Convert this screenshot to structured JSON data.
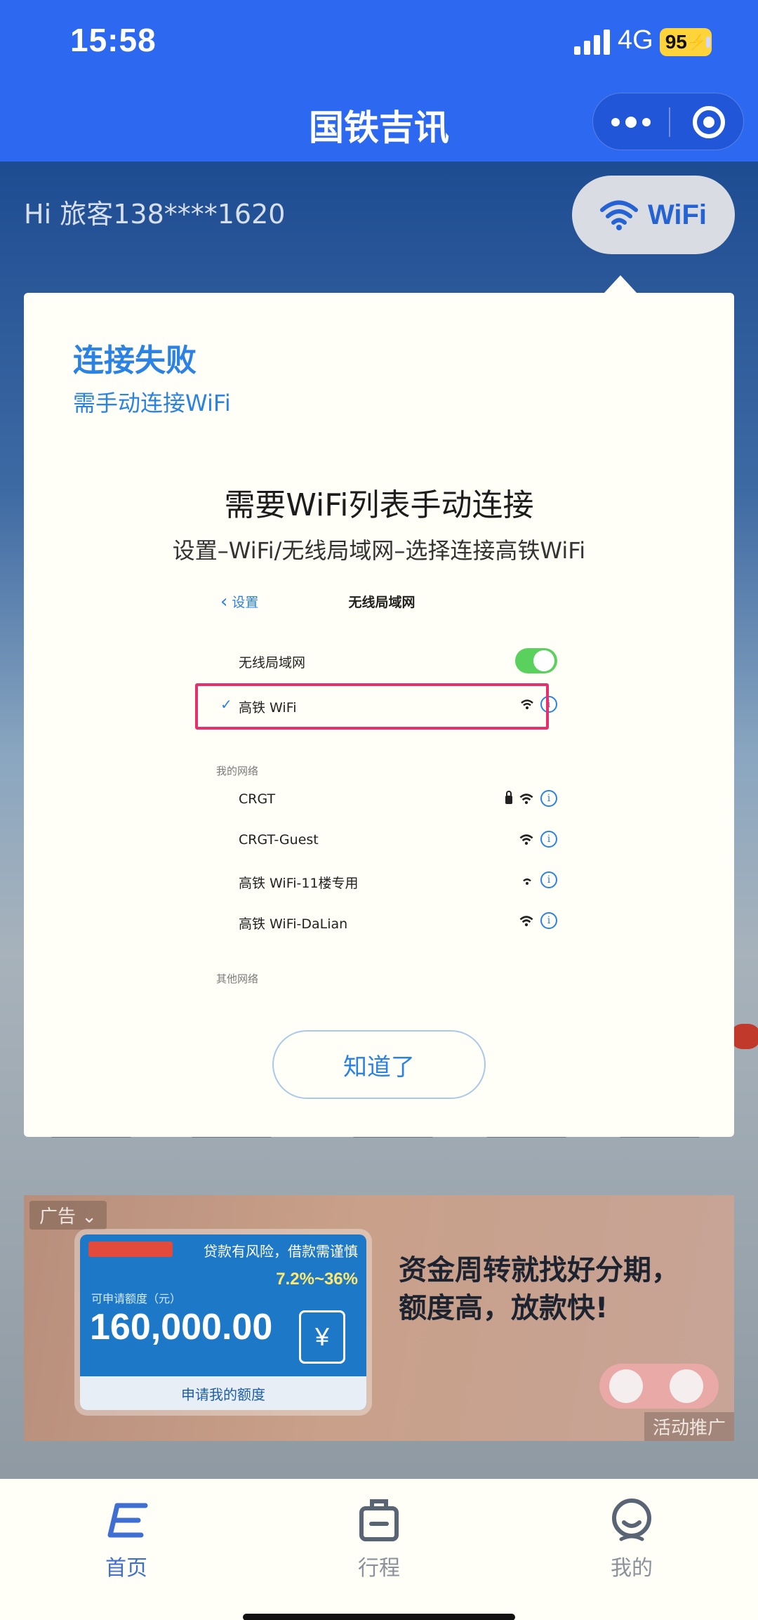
{
  "status_bar": {
    "time": "15:58",
    "network": "4G",
    "battery": "95"
  },
  "nav": {
    "title": "国铁吉讯",
    "more_icon": "more-dots-icon",
    "close_icon": "close-miniprogram-icon"
  },
  "page": {
    "greeting": "Hi 旅客138****1620",
    "wifi_button_label": "WiFi"
  },
  "modal": {
    "title": "连接失败",
    "subtitle": "需手动连接WiFi",
    "heading": "需要WiFi列表手动连接",
    "path": "设置–WiFi/无线局域网–选择连接高铁WiFi",
    "illustration": {
      "back_label": "设置",
      "nav_title": "无线局域网",
      "toggle_label": "无线局域网",
      "toggle_on": true,
      "connected_network": "高铁 WiFi",
      "my_networks_header": "我的网络",
      "networks": [
        {
          "name": "CRGT",
          "locked": true
        },
        {
          "name": "CRGT-Guest",
          "locked": false
        },
        {
          "name": "高铁 WiFi-11楼专用",
          "locked": false
        },
        {
          "name": "高铁 WiFi-DaLian",
          "locked": false
        }
      ],
      "other_networks_header": "其他网络",
      "highlight_color": "#e5306d"
    },
    "confirm_button": "知道了"
  },
  "ad": {
    "tag": "广告",
    "card_risk": "贷款有风险，借款需谨慎",
    "card_rate": "7.2%~36%",
    "card_limit_label": "可申请额度（元）",
    "card_amount": "160,000.00",
    "card_button": "申请我的额度",
    "headline": "资金周转就找好分期，额度高，放款快!",
    "promo_label": "活动推广"
  },
  "tabbar": {
    "items": [
      {
        "label": "首页",
        "icon": "home-e-icon",
        "active": true
      },
      {
        "label": "行程",
        "icon": "trip-bag-icon",
        "active": false
      },
      {
        "label": "我的",
        "icon": "profile-face-icon",
        "active": false
      }
    ]
  },
  "colors": {
    "brand_blue": "#2d68f0",
    "accent_blue": "#2a82e4",
    "modal_bg": "#fffef7",
    "toggle_green": "#5ad15c"
  }
}
